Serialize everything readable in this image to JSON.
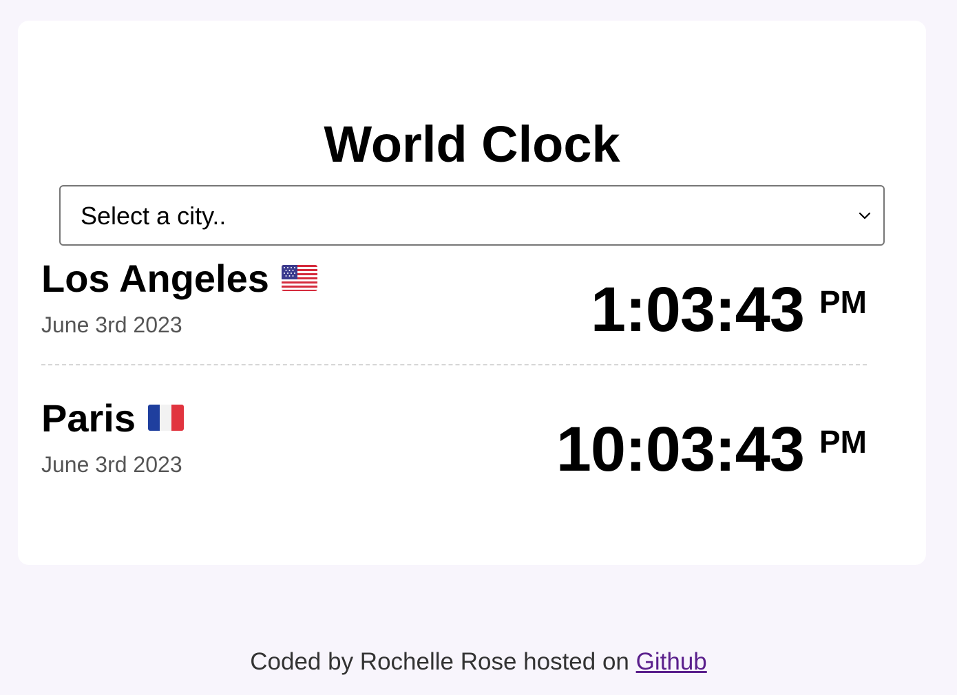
{
  "app": {
    "title": "World Clock"
  },
  "city_select": {
    "selected": "Select a city.."
  },
  "cities": [
    {
      "name": "Los Angeles",
      "flag_icon": "us-flag-icon",
      "date": "June 3rd 2023",
      "time": "1:03:43",
      "period": "PM"
    },
    {
      "name": "Paris",
      "flag_icon": "fr-flag-icon",
      "date": "June 3rd 2023",
      "time": "10:03:43",
      "period": "PM"
    }
  ],
  "footer": {
    "text": "Coded by Rochelle Rose hosted on",
    "link_label": "Github"
  },
  "colors": {
    "background": "#f8f5fc",
    "card": "#ffffff",
    "link": "#5a1f8c",
    "date_text": "#555555"
  }
}
